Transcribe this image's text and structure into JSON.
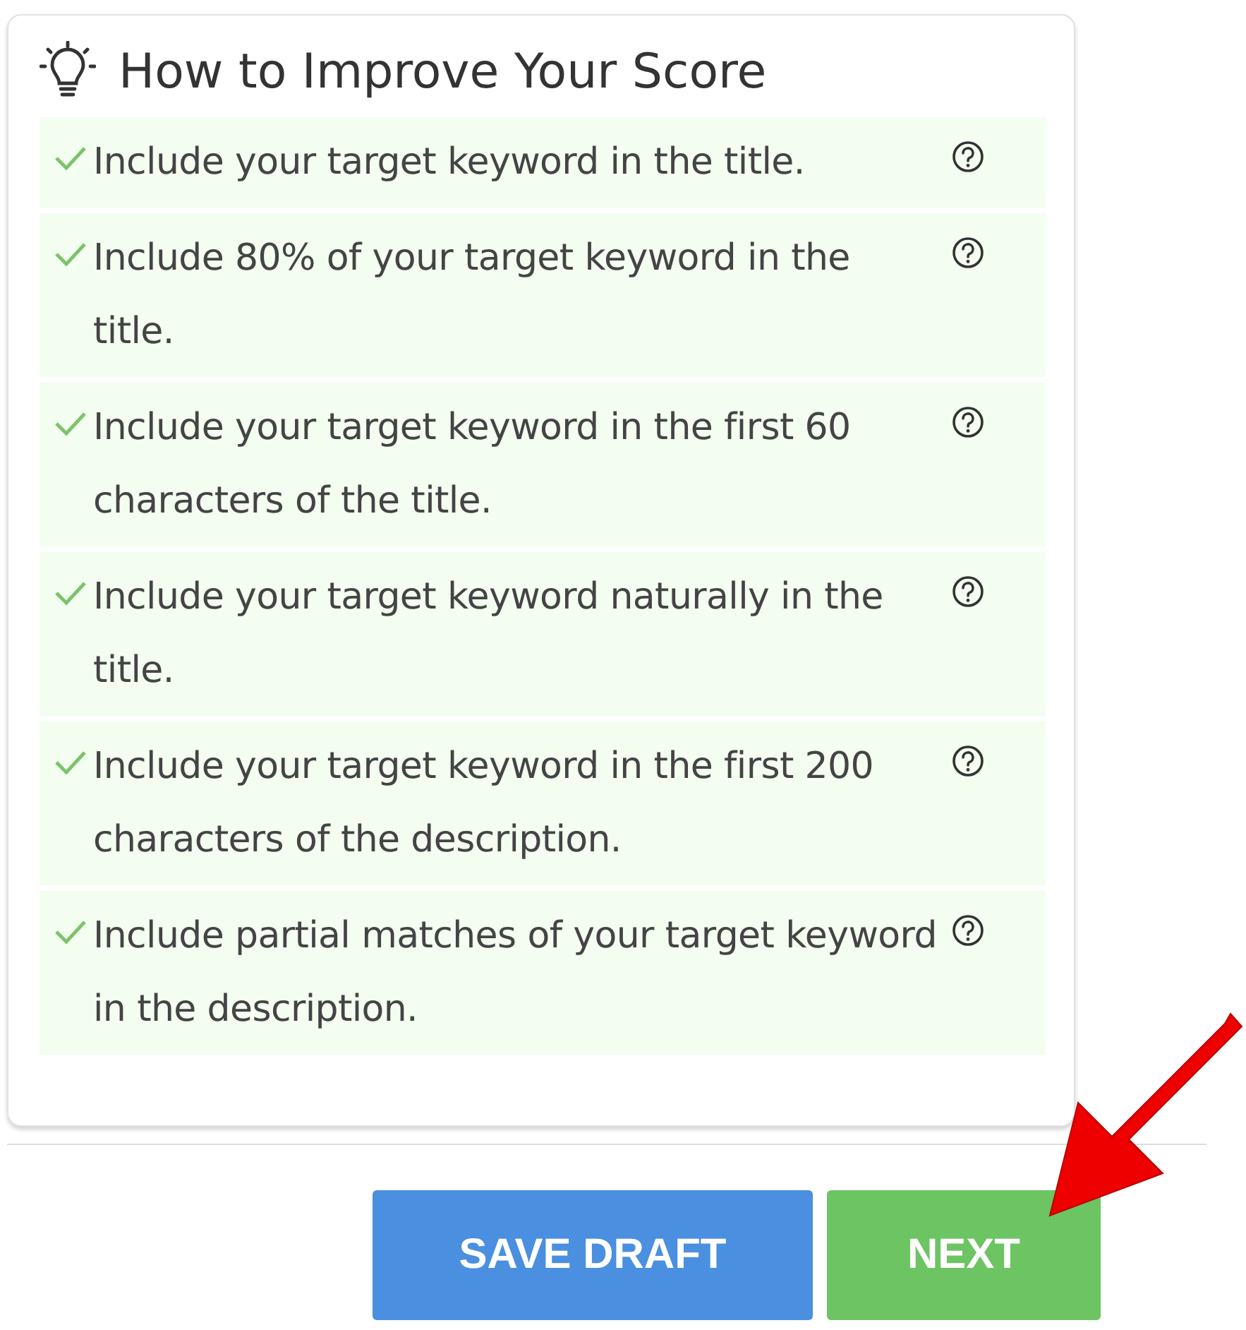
{
  "panel": {
    "title": "How to Improve Your Score"
  },
  "tips": [
    {
      "text": "Include your target keyword in the title.",
      "checked": true
    },
    {
      "text": "Include 80% of your target keyword in the title.",
      "checked": true
    },
    {
      "text": "Include your target keyword in the first 60 characters of the title.",
      "checked": true
    },
    {
      "text": "Include your target keyword naturally in the title.",
      "checked": true
    },
    {
      "text": "Include your target keyword in the first 200 characters of the description.",
      "checked": true
    },
    {
      "text": "Include partial matches of your target keyword in the description.",
      "checked": true
    }
  ],
  "buttons": [
    {
      "label": "SAVE DRAFT",
      "kind": "secondary"
    },
    {
      "label": "NEXT",
      "kind": "primary"
    }
  ]
}
